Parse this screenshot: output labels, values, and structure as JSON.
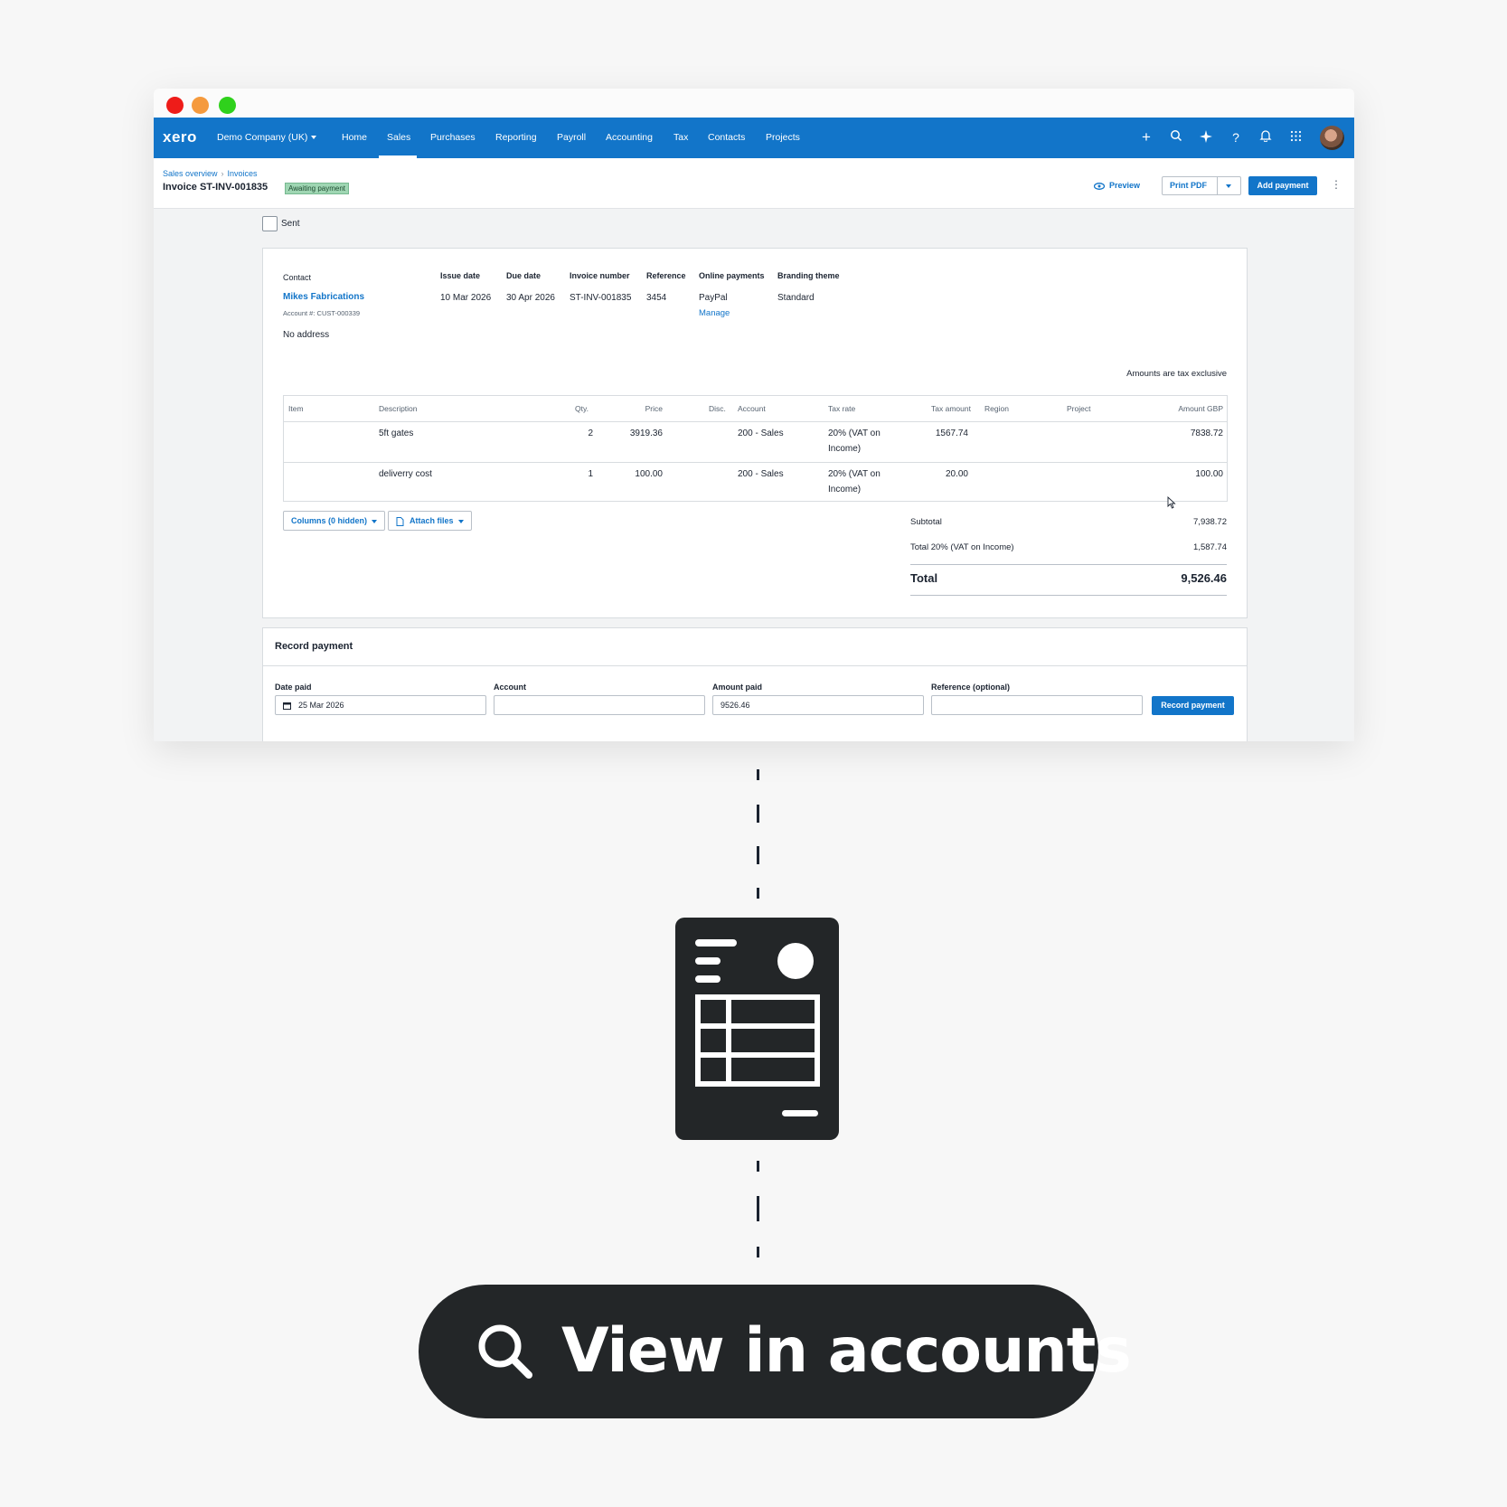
{
  "colors": {
    "brand": "#1275c9",
    "close": "#ee1c19",
    "minimize": "#f59a3d",
    "maximize": "#2fd11c",
    "pill": "#232628",
    "badge": "#9fd6b3"
  },
  "nav": {
    "logo": "xero",
    "org": "Demo Company (UK)",
    "items": [
      "Home",
      "Sales",
      "Purchases",
      "Reporting",
      "Payroll",
      "Accounting",
      "Tax",
      "Contacts",
      "Projects"
    ],
    "active": "Sales",
    "icons": [
      "plus-icon",
      "search-icon",
      "sparkle-icon",
      "help-icon",
      "bell-icon",
      "apps-grid-icon",
      "avatar"
    ]
  },
  "header": {
    "breadcrumb": [
      "Sales overview",
      "Invoices"
    ],
    "title": "Invoice ST-INV-001835",
    "status": "Awaiting payment",
    "preview": "Preview",
    "print_pdf": "Print PDF",
    "add_payment": "Add payment"
  },
  "sent": "Sent",
  "invoice": {
    "contact_label": "Contact",
    "contact_name": "Mikes Fabrications",
    "account_no": "Account #: CUST-000339",
    "address": "No address",
    "issue_date_label": "Issue date",
    "issue_date": "10 Mar 2026",
    "due_date_label": "Due date",
    "due_date": "30 Apr 2026",
    "invoice_number_label": "Invoice number",
    "invoice_number": "ST-INV-001835",
    "reference_label": "Reference",
    "reference": "3454",
    "online_payments_label": "Online payments",
    "online_payments": "PayPal",
    "manage": "Manage",
    "branding_label": "Branding theme",
    "branding": "Standard",
    "tax_note": "Amounts are tax exclusive"
  },
  "table": {
    "headers": [
      "Item",
      "Description",
      "Qty.",
      "Price",
      "Disc.",
      "Account",
      "Tax rate",
      "Tax amount",
      "Region",
      "Project",
      "Amount GBP"
    ],
    "rows": [
      {
        "item": "",
        "description": "5ft gates",
        "qty": "2",
        "price": "3919.36",
        "disc": "",
        "account": "200 - Sales",
        "tax_rate_1": "20% (VAT on",
        "tax_rate_2": "Income)",
        "tax_amount": "1567.74",
        "region": "",
        "project": "",
        "amount": "7838.72"
      },
      {
        "item": "",
        "description": "deliverry cost",
        "qty": "1",
        "price": "100.00",
        "disc": "",
        "account": "200 - Sales",
        "tax_rate_1": "20% (VAT on",
        "tax_rate_2": "Income)",
        "tax_amount": "20.00",
        "region": "",
        "project": "",
        "amount": "100.00"
      }
    ]
  },
  "actions": {
    "columns": "Columns (0 hidden)",
    "attach": "Attach files"
  },
  "totals": {
    "subtotal_label": "Subtotal",
    "subtotal": "7,938.72",
    "tax_label": "Total 20% (VAT on Income)",
    "tax": "1,587.74",
    "total_label": "Total",
    "total": "9,526.46"
  },
  "record_payment": {
    "title": "Record payment",
    "date_label": "Date paid",
    "date_value": "25 Mar 2026",
    "account_label": "Account",
    "account_value": "",
    "amount_label": "Amount paid",
    "amount_value": "9526.46",
    "reference_label": "Reference (optional)",
    "reference_value": "",
    "button": "Record payment"
  },
  "cta": {
    "label": "View in accounts",
    "icon": "search-icon"
  },
  "illustration": {
    "icon": "invoice-document-icon"
  }
}
